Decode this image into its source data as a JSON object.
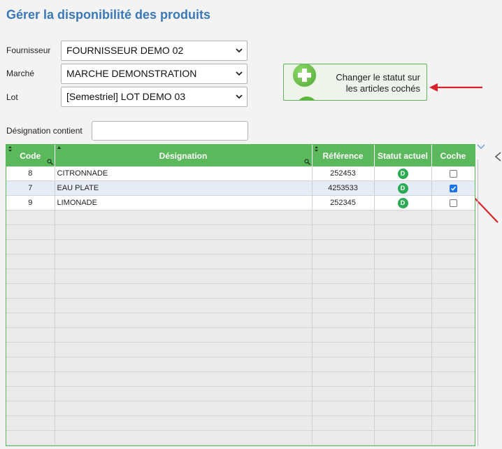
{
  "page": {
    "title": "Gérer la disponibilité des produits"
  },
  "filters": {
    "supplier": {
      "label": "Fournisseur",
      "value": "FOURNISSEUR DEMO 02"
    },
    "market": {
      "label": "Marché",
      "value": "MARCHE DEMONSTRATION"
    },
    "lot": {
      "label": "Lot",
      "value": "[Semestriel] LOT DEMO 03"
    },
    "designation": {
      "label": "Désignation contient",
      "value": ""
    }
  },
  "action": {
    "label_line1": "Changer le statut sur",
    "label_line2": "les articles cochés",
    "icon": "plus-icon"
  },
  "grid": {
    "headers": {
      "code": "Code",
      "designation": "Désignation",
      "reference": "Référence",
      "status": "Statut actuel",
      "check": "Coche"
    },
    "rows": [
      {
        "code": "8",
        "designation": "CITRONNADE",
        "reference": "252453",
        "status": "D",
        "checked": false
      },
      {
        "code": "7",
        "designation": "EAU PLATE",
        "reference": "4253533",
        "status": "D",
        "checked": true
      },
      {
        "code": "9",
        "designation": "LIMONADE",
        "reference": "252345",
        "status": "D",
        "checked": false
      }
    ],
    "empty_rows": 16
  },
  "colors": {
    "accent_green": "#5cb85c",
    "title_blue": "#3a78b8",
    "status_green": "#2eaa55",
    "annotation_red": "#d9232b",
    "checkbox_blue": "#1a73e8"
  }
}
